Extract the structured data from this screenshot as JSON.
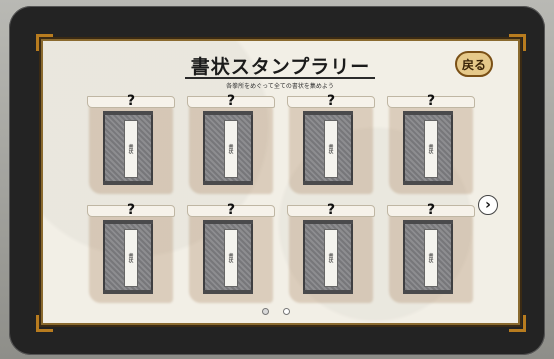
{
  "header": {
    "title": "書状スタンプラリー",
    "subtitle": "各拳所をめぐって全ての書状を集めよう"
  },
  "buttons": {
    "back_label": "戻る",
    "next_icon": "chevron-right-icon"
  },
  "stamps": [
    {
      "mark": "?",
      "label": "書状"
    },
    {
      "mark": "?",
      "label": "書状"
    },
    {
      "mark": "?",
      "label": "書状"
    },
    {
      "mark": "?",
      "label": "書状"
    },
    {
      "mark": "?",
      "label": "書状"
    },
    {
      "mark": "?",
      "label": "書状"
    },
    {
      "mark": "?",
      "label": "書状"
    },
    {
      "mark": "?",
      "label": "書状"
    }
  ],
  "pagination": {
    "current": 1,
    "total": 2
  },
  "colors": {
    "frame": "#b87c1f",
    "parchment": "#f2efe6",
    "book": "#7f7f82"
  }
}
